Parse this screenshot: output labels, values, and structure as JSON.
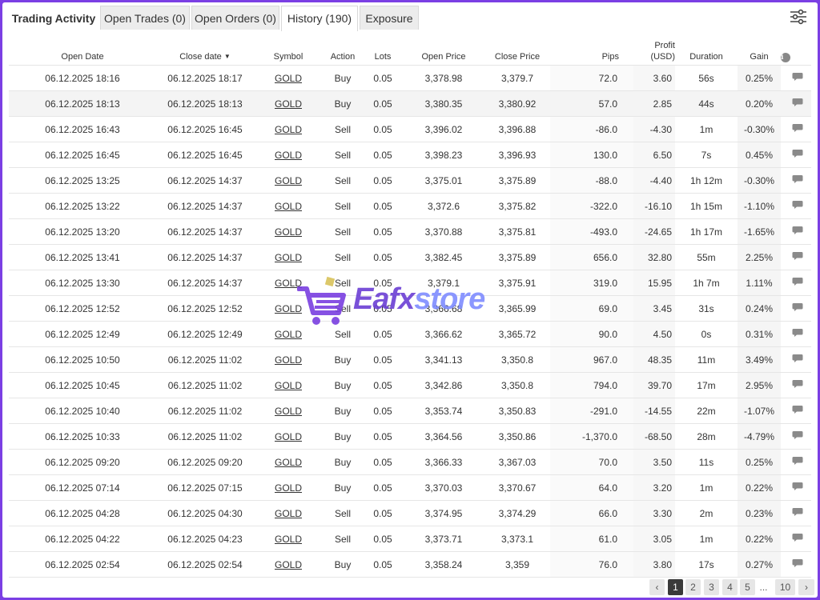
{
  "tabs": [
    {
      "label": "Trading Activity",
      "name": "tab-trading-activity"
    },
    {
      "label": "Open Trades (0)",
      "name": "tab-open-trades"
    },
    {
      "label": "Open Orders (0)",
      "name": "tab-open-orders"
    },
    {
      "label": "History (190)",
      "name": "tab-history"
    },
    {
      "label": "Exposure",
      "name": "tab-exposure"
    }
  ],
  "active_tab": "History (190)",
  "settings_icon": "sliders-icon",
  "columns": {
    "open_date": "Open Date",
    "close_date": "Close date",
    "close_date_sort": "▼",
    "symbol": "Symbol",
    "action": "Action",
    "lots": "Lots",
    "open_price": "Open Price",
    "close_price": "Close Price",
    "pips": "Pips",
    "profit": "Profit",
    "profit_unit": "(USD)",
    "duration": "Duration",
    "gain": "Gain",
    "info": "i"
  },
  "rows": [
    {
      "open": "06.12.2025 18:16",
      "close": "06.12.2025 18:17",
      "symbol": "GOLD",
      "action": "Buy",
      "lots": "0.05",
      "open_price": "3,378.98",
      "close_price": "3,379.7",
      "pips": "72.0",
      "profit": "3.60",
      "duration": "56s",
      "gain": "0.25%"
    },
    {
      "open": "06.12.2025 18:13",
      "close": "06.12.2025 18:13",
      "symbol": "GOLD",
      "action": "Buy",
      "lots": "0.05",
      "open_price": "3,380.35",
      "close_price": "3,380.92",
      "pips": "57.0",
      "profit": "2.85",
      "duration": "44s",
      "gain": "0.20%"
    },
    {
      "open": "06.12.2025 16:43",
      "close": "06.12.2025 16:45",
      "symbol": "GOLD",
      "action": "Sell",
      "lots": "0.05",
      "open_price": "3,396.02",
      "close_price": "3,396.88",
      "pips": "-86.0",
      "profit": "-4.30",
      "duration": "1m",
      "gain": "-0.30%"
    },
    {
      "open": "06.12.2025 16:45",
      "close": "06.12.2025 16:45",
      "symbol": "GOLD",
      "action": "Sell",
      "lots": "0.05",
      "open_price": "3,398.23",
      "close_price": "3,396.93",
      "pips": "130.0",
      "profit": "6.50",
      "duration": "7s",
      "gain": "0.45%"
    },
    {
      "open": "06.12.2025 13:25",
      "close": "06.12.2025 14:37",
      "symbol": "GOLD",
      "action": "Sell",
      "lots": "0.05",
      "open_price": "3,375.01",
      "close_price": "3,375.89",
      "pips": "-88.0",
      "profit": "-4.40",
      "duration": "1h 12m",
      "gain": "-0.30%"
    },
    {
      "open": "06.12.2025 13:22",
      "close": "06.12.2025 14:37",
      "symbol": "GOLD",
      "action": "Sell",
      "lots": "0.05",
      "open_price": "3,372.6",
      "close_price": "3,375.82",
      "pips": "-322.0",
      "profit": "-16.10",
      "duration": "1h 15m",
      "gain": "-1.10%"
    },
    {
      "open": "06.12.2025 13:20",
      "close": "06.12.2025 14:37",
      "symbol": "GOLD",
      "action": "Sell",
      "lots": "0.05",
      "open_price": "3,370.88",
      "close_price": "3,375.81",
      "pips": "-493.0",
      "profit": "-24.65",
      "duration": "1h 17m",
      "gain": "-1.65%"
    },
    {
      "open": "06.12.2025 13:41",
      "close": "06.12.2025 14:37",
      "symbol": "GOLD",
      "action": "Sell",
      "lots": "0.05",
      "open_price": "3,382.45",
      "close_price": "3,375.89",
      "pips": "656.0",
      "profit": "32.80",
      "duration": "55m",
      "gain": "2.25%"
    },
    {
      "open": "06.12.2025 13:30",
      "close": "06.12.2025 14:37",
      "symbol": "GOLD",
      "action": "Sell",
      "lots": "0.05",
      "open_price": "3,379.1",
      "close_price": "3,375.91",
      "pips": "319.0",
      "profit": "15.95",
      "duration": "1h 7m",
      "gain": "1.11%"
    },
    {
      "open": "06.12.2025 12:52",
      "close": "06.12.2025 12:52",
      "symbol": "GOLD",
      "action": "Sell",
      "lots": "0.05",
      "open_price": "3,366.68",
      "close_price": "3,365.99",
      "pips": "69.0",
      "profit": "3.45",
      "duration": "31s",
      "gain": "0.24%"
    },
    {
      "open": "06.12.2025 12:49",
      "close": "06.12.2025 12:49",
      "symbol": "GOLD",
      "action": "Sell",
      "lots": "0.05",
      "open_price": "3,366.62",
      "close_price": "3,365.72",
      "pips": "90.0",
      "profit": "4.50",
      "duration": "0s",
      "gain": "0.31%"
    },
    {
      "open": "06.12.2025 10:50",
      "close": "06.12.2025 11:02",
      "symbol": "GOLD",
      "action": "Buy",
      "lots": "0.05",
      "open_price": "3,341.13",
      "close_price": "3,350.8",
      "pips": "967.0",
      "profit": "48.35",
      "duration": "11m",
      "gain": "3.49%"
    },
    {
      "open": "06.12.2025 10:45",
      "close": "06.12.2025 11:02",
      "symbol": "GOLD",
      "action": "Buy",
      "lots": "0.05",
      "open_price": "3,342.86",
      "close_price": "3,350.8",
      "pips": "794.0",
      "profit": "39.70",
      "duration": "17m",
      "gain": "2.95%"
    },
    {
      "open": "06.12.2025 10:40",
      "close": "06.12.2025 11:02",
      "symbol": "GOLD",
      "action": "Buy",
      "lots": "0.05",
      "open_price": "3,353.74",
      "close_price": "3,350.83",
      "pips": "-291.0",
      "profit": "-14.55",
      "duration": "22m",
      "gain": "-1.07%"
    },
    {
      "open": "06.12.2025 10:33",
      "close": "06.12.2025 11:02",
      "symbol": "GOLD",
      "action": "Buy",
      "lots": "0.05",
      "open_price": "3,364.56",
      "close_price": "3,350.86",
      "pips": "-1,370.0",
      "profit": "-68.50",
      "duration": "28m",
      "gain": "-4.79%"
    },
    {
      "open": "06.12.2025 09:20",
      "close": "06.12.2025 09:20",
      "symbol": "GOLD",
      "action": "Buy",
      "lots": "0.05",
      "open_price": "3,366.33",
      "close_price": "3,367.03",
      "pips": "70.0",
      "profit": "3.50",
      "duration": "11s",
      "gain": "0.25%"
    },
    {
      "open": "06.12.2025 07:14",
      "close": "06.12.2025 07:15",
      "symbol": "GOLD",
      "action": "Buy",
      "lots": "0.05",
      "open_price": "3,370.03",
      "close_price": "3,370.67",
      "pips": "64.0",
      "profit": "3.20",
      "duration": "1m",
      "gain": "0.22%"
    },
    {
      "open": "06.12.2025 04:28",
      "close": "06.12.2025 04:30",
      "symbol": "GOLD",
      "action": "Sell",
      "lots": "0.05",
      "open_price": "3,374.95",
      "close_price": "3,374.29",
      "pips": "66.0",
      "profit": "3.30",
      "duration": "2m",
      "gain": "0.23%"
    },
    {
      "open": "06.12.2025 04:22",
      "close": "06.12.2025 04:23",
      "symbol": "GOLD",
      "action": "Sell",
      "lots": "0.05",
      "open_price": "3,373.71",
      "close_price": "3,373.1",
      "pips": "61.0",
      "profit": "3.05",
      "duration": "1m",
      "gain": "0.22%"
    },
    {
      "open": "06.12.2025 02:54",
      "close": "06.12.2025 02:54",
      "symbol": "GOLD",
      "action": "Buy",
      "lots": "0.05",
      "open_price": "3,358.24",
      "close_price": "3,359",
      "pips": "76.0",
      "profit": "3.80",
      "duration": "17s",
      "gain": "0.27%"
    }
  ],
  "colors": {
    "positive": "#24a148",
    "negative": "#d9363e",
    "frame": "#7b3fe4"
  },
  "row_icon": "comment-icon",
  "watermark": {
    "part1": "Eafx",
    "part2": "store",
    "icon": "shopping-cart-icon"
  },
  "pagination": {
    "prev": "‹",
    "pages": [
      "1",
      "2",
      "3",
      "4",
      "5"
    ],
    "ellipsis": "...",
    "last": "10",
    "next": "›",
    "current": "1"
  }
}
